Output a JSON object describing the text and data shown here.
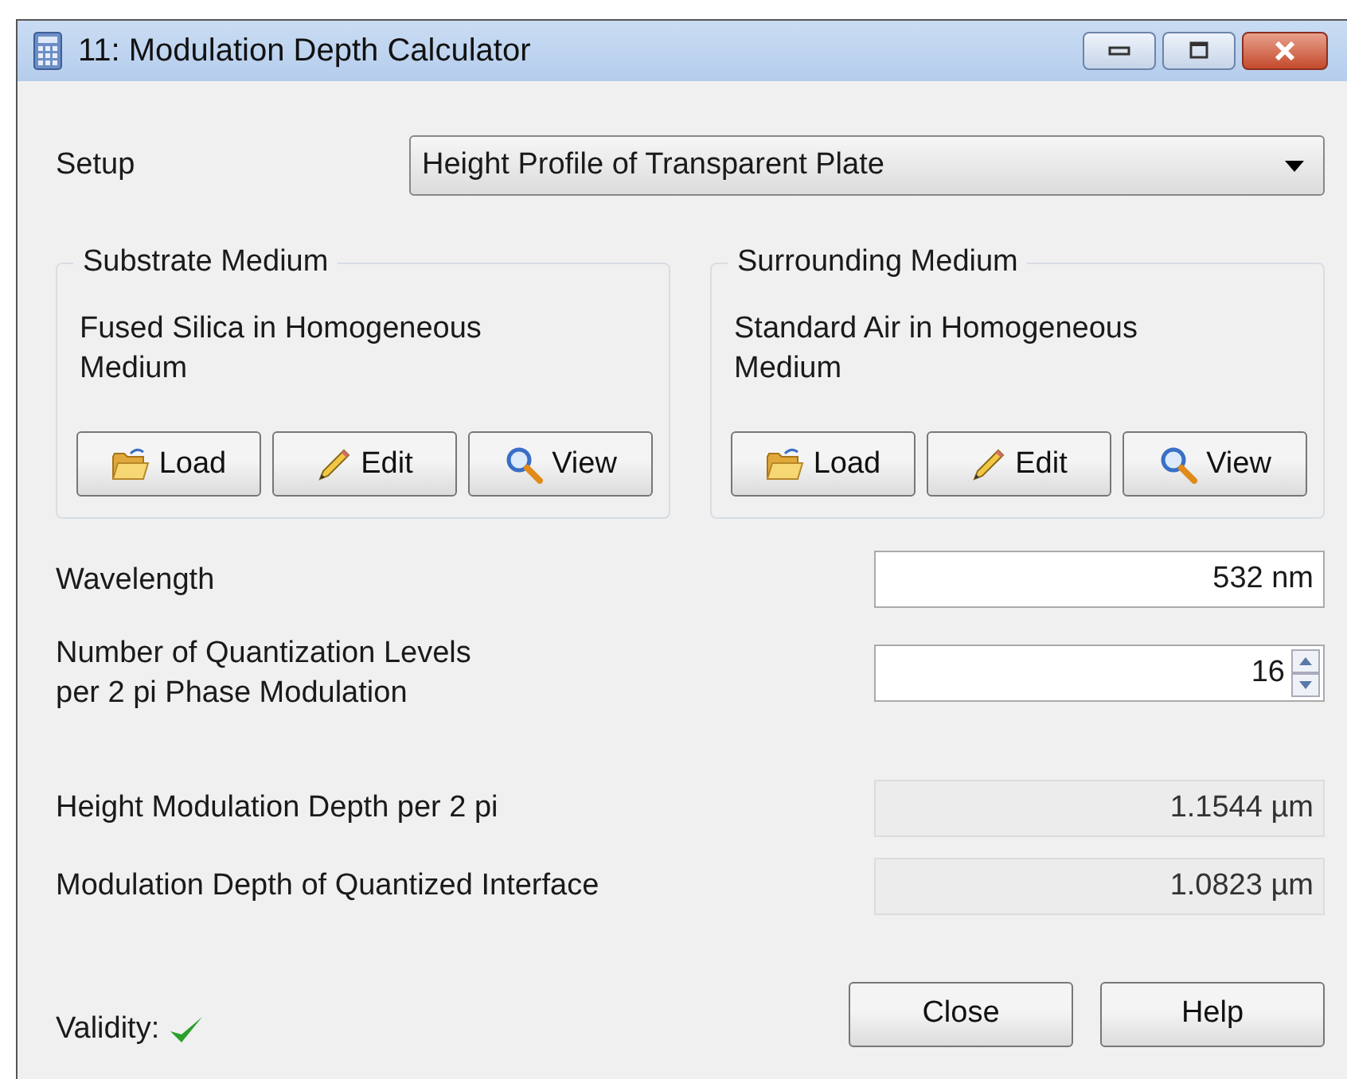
{
  "window": {
    "title": "11: Modulation Depth Calculator"
  },
  "setup": {
    "label": "Setup",
    "value": "Height Profile of Transparent Plate"
  },
  "media": [
    {
      "title": "Substrate Medium",
      "description": "Fused Silica in Homogeneous Medium",
      "buttons": [
        {
          "kind": "load",
          "label": "Load"
        },
        {
          "kind": "edit",
          "label": "Edit"
        },
        {
          "kind": "view",
          "label": "View"
        }
      ]
    },
    {
      "title": "Surrounding Medium",
      "description": "Standard Air in Homogeneous Medium",
      "buttons": [
        {
          "kind": "load",
          "label": "Load"
        },
        {
          "kind": "edit",
          "label": "Edit"
        },
        {
          "kind": "view",
          "label": "View"
        }
      ]
    }
  ],
  "inputs": [
    {
      "kind": "text",
      "label": "Wavelength",
      "value": "532 nm"
    },
    {
      "kind": "spin",
      "label": "Number of Quantization Levels per 2 pi Phase Modulation",
      "value": "16"
    }
  ],
  "outputs": [
    {
      "label": "Height Modulation Depth per 2 pi",
      "value": "1.1544 µm"
    },
    {
      "label": "Modulation Depth of Quantized Interface",
      "value": "1.0823 µm"
    }
  ],
  "validity": {
    "label": "Validity:",
    "valid": true
  },
  "buttons": [
    "Close",
    "Help"
  ]
}
